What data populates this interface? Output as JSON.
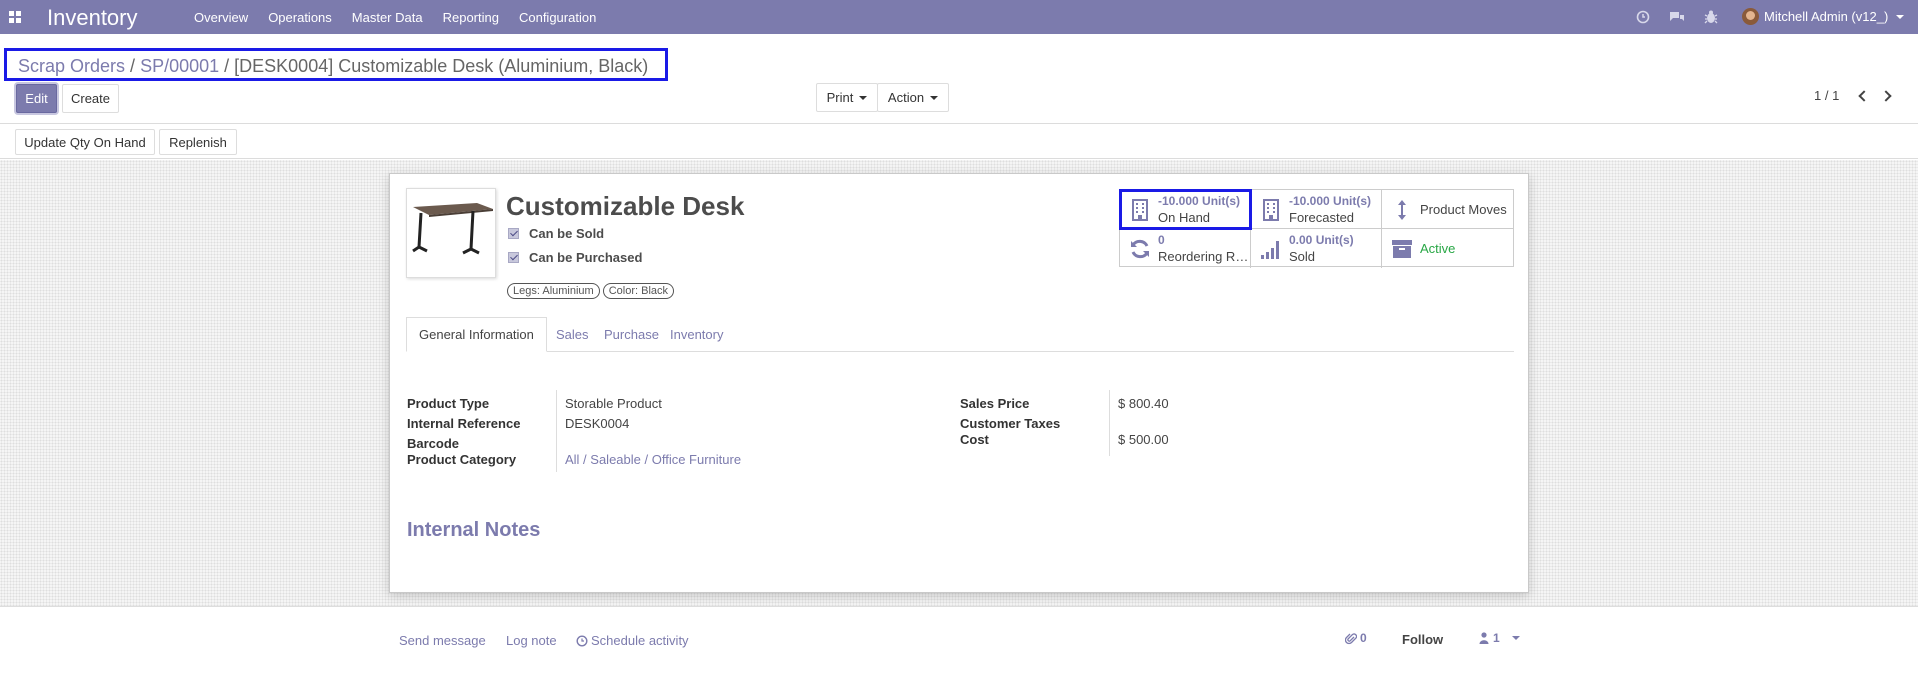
{
  "navbar": {
    "app_name": "Inventory",
    "menu": [
      "Overview",
      "Operations",
      "Master Data",
      "Reporting",
      "Configuration"
    ],
    "user": "Mitchell Admin (v12_)",
    "bg_color": "#7c7bad"
  },
  "breadcrumb": {
    "items": [
      "Scrap Orders",
      "SP/00001"
    ],
    "current": "[DESK0004] Customizable Desk (Aluminium, Black)"
  },
  "buttons": {
    "edit": "Edit",
    "create": "Create",
    "print": "Print",
    "action": "Action",
    "update_qty": "Update Qty On Hand",
    "replenish": "Replenish"
  },
  "pager": {
    "value": "1 / 1"
  },
  "product": {
    "name": "Customizable Desk",
    "can_be_sold": "Can be Sold",
    "can_be_purchased": "Can be Purchased",
    "tags": [
      "Legs: Aluminium",
      "Color: Black"
    ]
  },
  "smart_buttons": {
    "on_hand": {
      "value": "-10.000 Unit(s)",
      "label": "On Hand"
    },
    "forecasted": {
      "value": "-10.000 Unit(s)",
      "label": "Forecasted"
    },
    "product_moves": {
      "label": "Product Moves"
    },
    "reordering": {
      "value": "0",
      "label": "Reordering Rules"
    },
    "sold": {
      "value": "0.00 Unit(s)",
      "label": "Sold"
    },
    "active": {
      "label": "Active"
    }
  },
  "tabs": [
    "General Information",
    "Sales",
    "Purchase",
    "Inventory"
  ],
  "general": {
    "product_type_label": "Product Type",
    "product_type": "Storable Product",
    "internal_ref_label": "Internal Reference",
    "internal_ref": "DESK0004",
    "barcode_label": "Barcode",
    "category_label": "Product Category",
    "category": "All / Saleable / Office Furniture",
    "sales_price_label": "Sales Price",
    "sales_price": "$ 800.40",
    "customer_taxes_label": "Customer Taxes",
    "cost_label": "Cost",
    "cost": "$ 500.00"
  },
  "notes_title": "Internal Notes",
  "chatter": {
    "send_message": "Send message",
    "log_note": "Log note",
    "schedule_activity": "Schedule activity",
    "attachments": "0",
    "follow": "Follow",
    "followers": "1"
  }
}
